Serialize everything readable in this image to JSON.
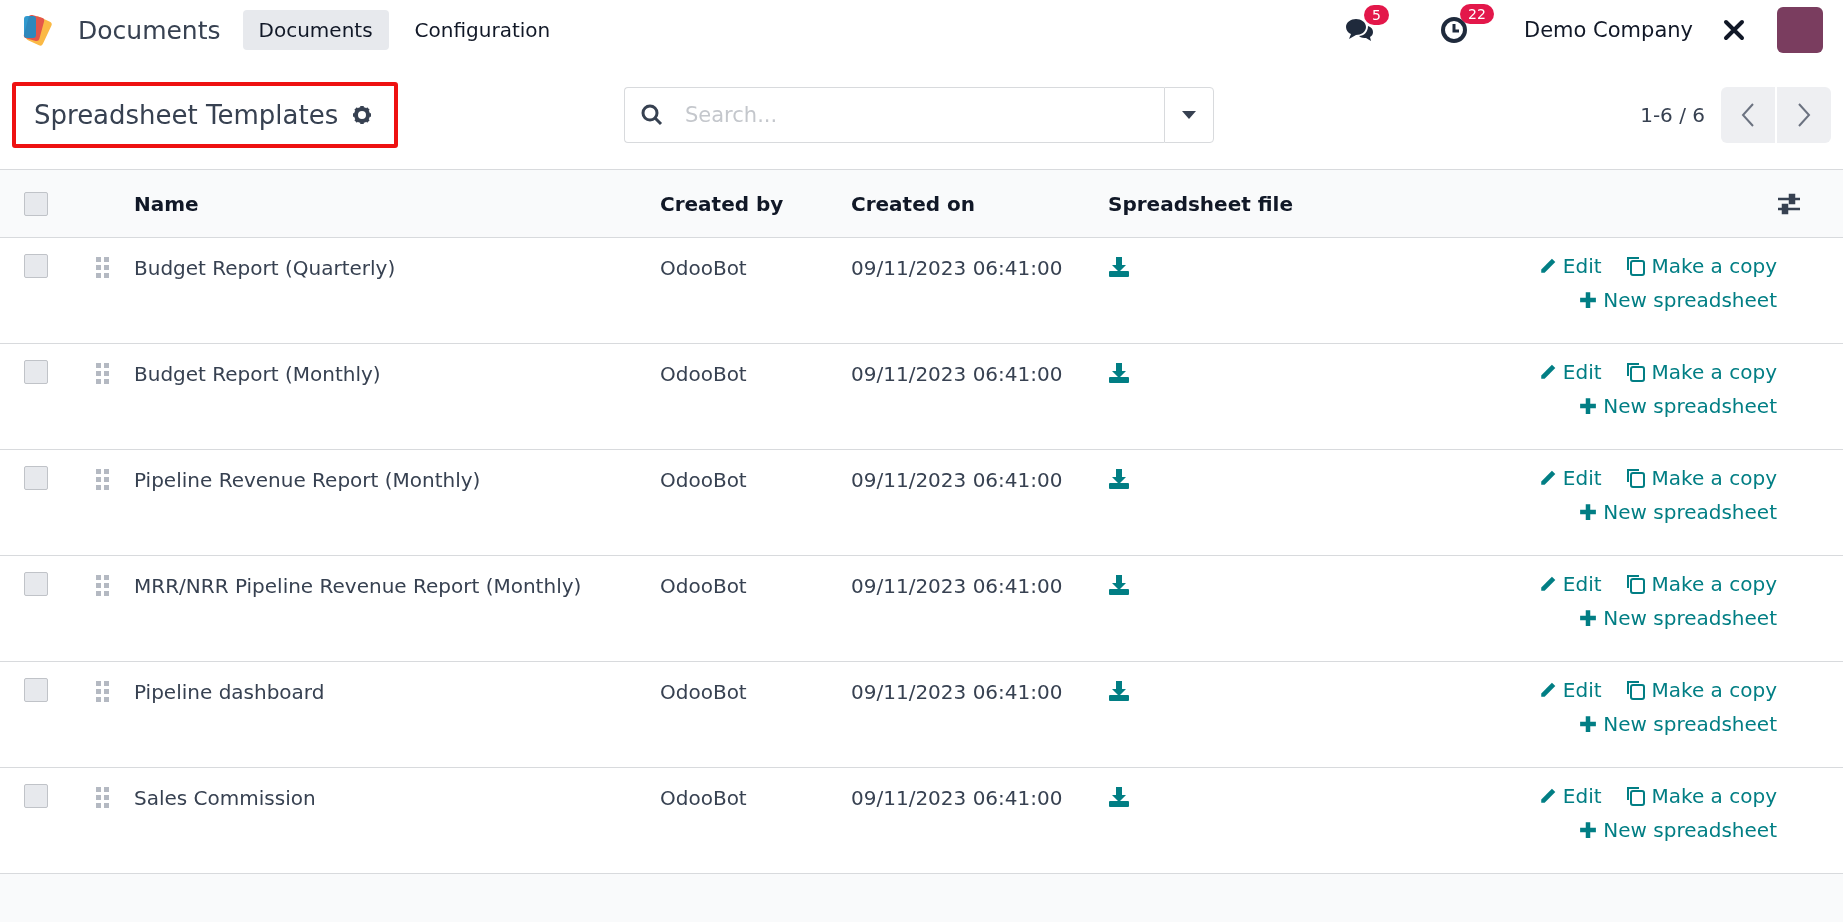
{
  "navbar": {
    "app_name": "Documents",
    "menu": [
      {
        "label": "Documents",
        "selected": true
      },
      {
        "label": "Configuration",
        "selected": false
      }
    ],
    "messages_count": "5",
    "activities_count": "22",
    "company": "Demo Company"
  },
  "control_panel": {
    "title": "Spreadsheet Templates",
    "highlighted": true,
    "search": {
      "placeholder": "Search..."
    },
    "pager": "1-6 / 6"
  },
  "table": {
    "select_all": {
      "checked": false
    },
    "columns": [
      "Name",
      "Created by",
      "Created on",
      "Spreadsheet file"
    ],
    "rows": [
      {
        "name": "Budget Report (Quarterly)",
        "created_by": "OdooBot",
        "created_on": "09/11/2023 06:41:00",
        "checked": false,
        "actions": [
          {
            "kind": "edit",
            "label": "Edit"
          },
          {
            "kind": "copy",
            "label": "Make a copy"
          },
          {
            "kind": "new",
            "label": "New spreadsheet"
          }
        ]
      },
      {
        "name": "Budget Report (Monthly)",
        "created_by": "OdooBot",
        "created_on": "09/11/2023 06:41:00",
        "checked": false,
        "actions": [
          {
            "kind": "edit",
            "label": "Edit"
          },
          {
            "kind": "copy",
            "label": "Make a copy"
          },
          {
            "kind": "new",
            "label": "New spreadsheet"
          }
        ]
      },
      {
        "name": "Pipeline Revenue Report (Monthly)",
        "created_by": "OdooBot",
        "created_on": "09/11/2023 06:41:00",
        "checked": false,
        "actions": [
          {
            "kind": "edit",
            "label": "Edit"
          },
          {
            "kind": "copy",
            "label": "Make a copy"
          },
          {
            "kind": "new",
            "label": "New spreadsheet"
          }
        ]
      },
      {
        "name": "MRR/NRR Pipeline Revenue Report (Monthly)",
        "created_by": "OdooBot",
        "created_on": "09/11/2023 06:41:00",
        "checked": false,
        "actions": [
          {
            "kind": "edit",
            "label": "Edit"
          },
          {
            "kind": "copy",
            "label": "Make a copy"
          },
          {
            "kind": "new",
            "label": "New spreadsheet"
          }
        ]
      },
      {
        "name": "Pipeline dashboard",
        "created_by": "OdooBot",
        "created_on": "09/11/2023 06:41:00",
        "checked": false,
        "actions": [
          {
            "kind": "edit",
            "label": "Edit"
          },
          {
            "kind": "copy",
            "label": "Make a copy"
          },
          {
            "kind": "new",
            "label": "New spreadsheet"
          }
        ]
      },
      {
        "name": "Sales Commission",
        "created_by": "OdooBot",
        "created_on": "09/11/2023 06:41:00",
        "checked": false,
        "actions": [
          {
            "kind": "edit",
            "label": "Edit"
          },
          {
            "kind": "copy",
            "label": "Make a copy"
          },
          {
            "kind": "new",
            "label": "New spreadsheet"
          }
        ]
      }
    ]
  }
}
